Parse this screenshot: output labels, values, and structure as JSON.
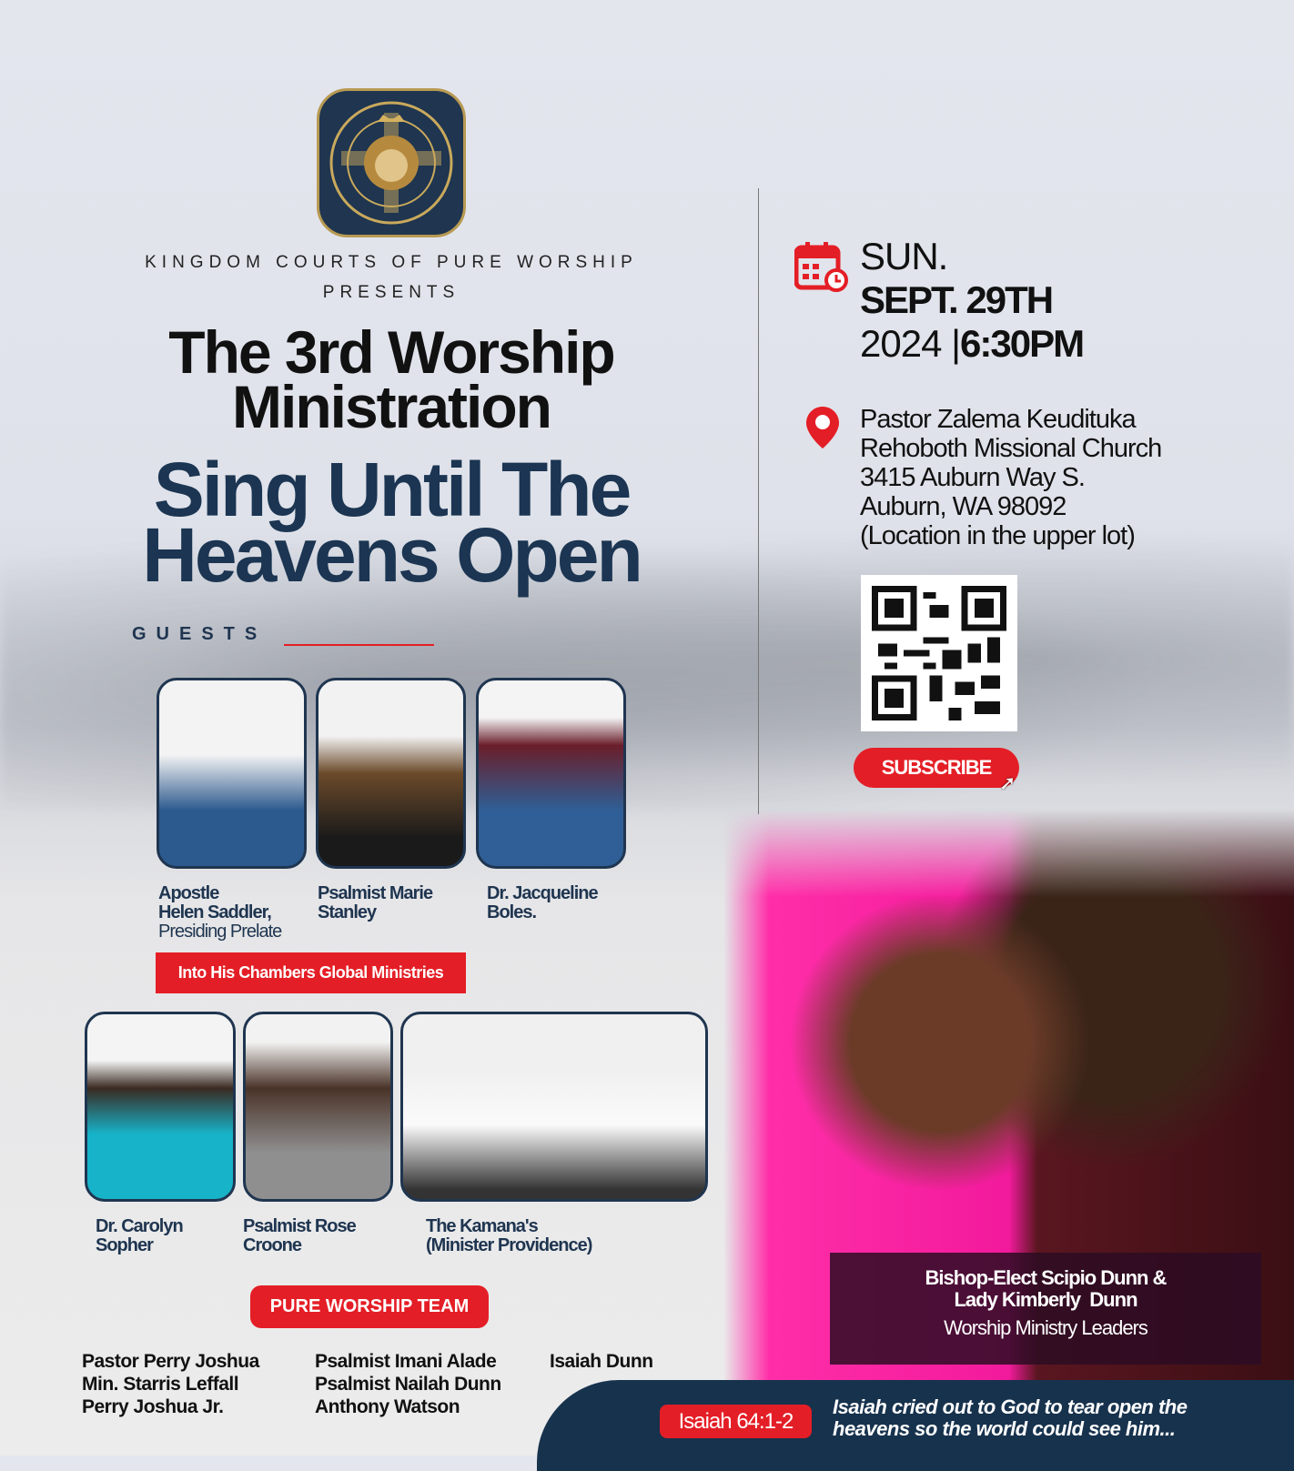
{
  "logo": {
    "text": "KINGDOM COURTS OF PURE WORSHIP"
  },
  "header": {
    "org": "KINGDOM COURTS OF PURE WORSHIP",
    "presents": "PRESENTS",
    "title_line1": "The 3rd Worship",
    "title_line2": "Ministration",
    "theme_line1": "Sing Until The",
    "theme_line2": "Heavens Open"
  },
  "guests": {
    "label": "GUESTS",
    "row1": [
      {
        "line1": "Apostle",
        "line2": "Helen Saddler,",
        "line3": "Presiding Prelate"
      },
      {
        "line1": "Psalmist Marie",
        "line2": "Stanley"
      },
      {
        "line1": "Dr. Jacqueline",
        "line2": "Boles."
      }
    ],
    "ministry_badge": "Into His Chambers Global Ministries",
    "row2": [
      {
        "line1": "Dr. Carolyn",
        "line2": "Sopher"
      },
      {
        "line1": "Psalmist Rose",
        "line2": "Croone"
      },
      {
        "line1": "The Kamana's",
        "line2": "(Minister Providence)"
      }
    ]
  },
  "team": {
    "label": "PURE WORSHIP TEAM",
    "columns": [
      [
        "Pastor Perry Joshua",
        "Min. Starris Leffall",
        "Perry Joshua Jr."
      ],
      [
        "Psalmist Imani Alade",
        "Psalmist Nailah Dunn",
        "Anthony Watson"
      ],
      [
        "Isaiah Dunn"
      ]
    ]
  },
  "event": {
    "day": "SUN.",
    "date": "SEPT. 29TH",
    "year": "2024",
    "separator": "|",
    "time": "6:30PM",
    "address": [
      "Pastor Zalema Keudituka",
      "Rehoboth Missional Church",
      "3415 Auburn Way S.",
      "Auburn, WA 98092",
      "(Location in the upper lot)"
    ],
    "subscribe": "SUBSCRIBE"
  },
  "leaders": {
    "names_line1": "Bishop-Elect Scipio Dunn &",
    "names_line2": "Lady Kimberly  Dunn",
    "role": "Worship Ministry Leaders"
  },
  "footer": {
    "verse_ref": "Isaiah 64:1-2",
    "verse_line1": "Isaiah cried out to God to tear open the",
    "verse_line2": "heavens so the world could see him..."
  },
  "colors": {
    "navy": "#1b3552",
    "red": "#e41e26"
  }
}
